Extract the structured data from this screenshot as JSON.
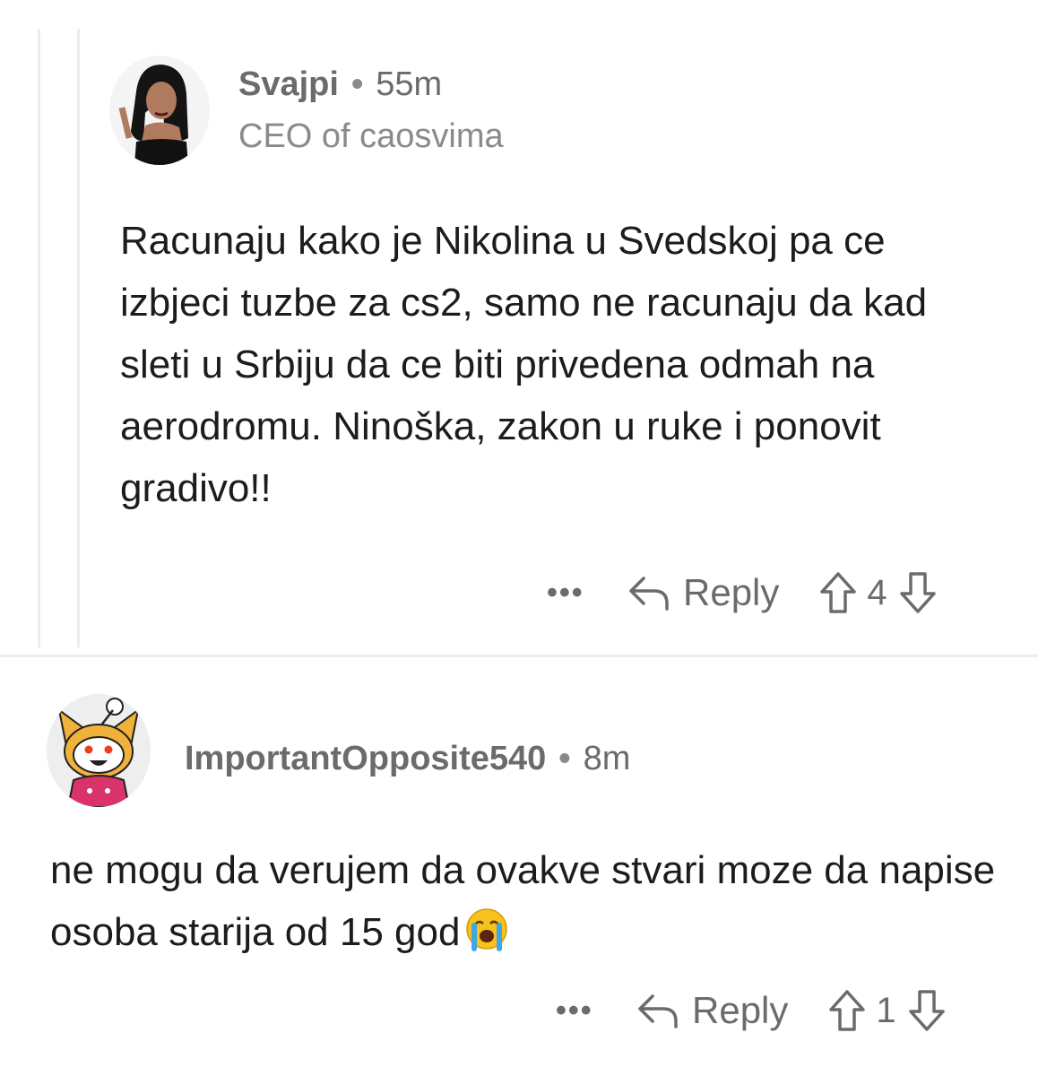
{
  "comments": [
    {
      "author": "Svajpi",
      "separator": "•",
      "time": "55m",
      "flair": "CEO of caosvima",
      "body": "Racunaju kako je Nikolina u Svedskoj pa ce izbjeci tuzbe za cs2, samo ne racunaju da kad sleti u Srbiju da ce biti privedena odmah na aerodromu. Ninoška, zakon u ruke i ponovit gradivo!!",
      "more": "•••",
      "reply_label": "Reply",
      "score": "4"
    },
    {
      "author": "ImportantOpposite540",
      "separator": "•",
      "time": "8m",
      "body": "ne mogu da verujem da ovakve stvari moze da napise osoba starija od 15 god",
      "emoji": "loudly-crying-face",
      "more": "•••",
      "reply_label": "Reply",
      "score": "1"
    }
  ],
  "colors": {
    "meta_text": "#6b6b6b",
    "body_text": "#1c1c1c",
    "thread_line": "#ececec"
  }
}
